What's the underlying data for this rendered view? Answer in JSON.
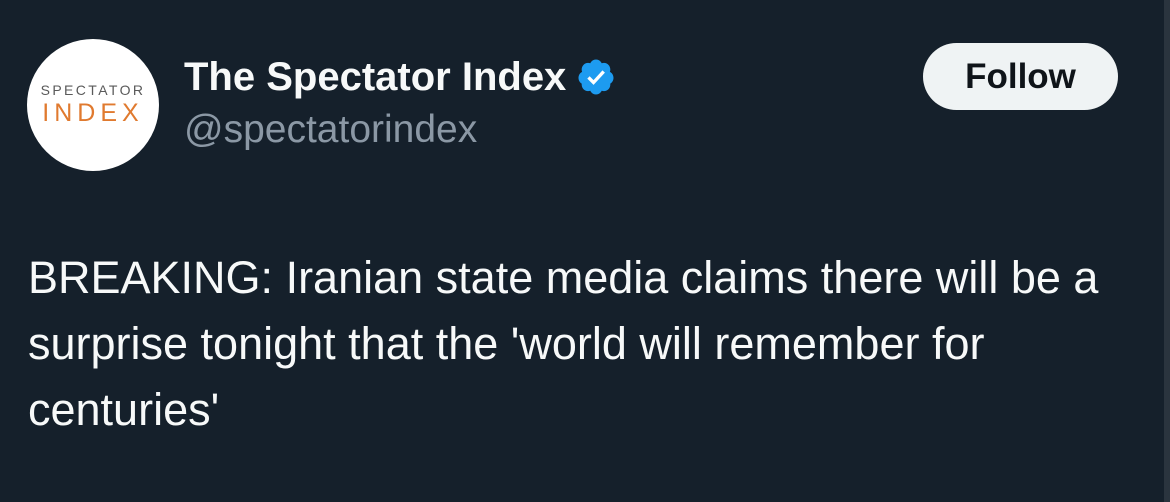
{
  "tweet": {
    "avatar": {
      "logo_top": "SPECTATOR",
      "logo_bottom": "INDEX",
      "logo_top_color": "#5a5a5a",
      "logo_bottom_color": "#e07a2f"
    },
    "display_name": "The Spectator Index",
    "verified": true,
    "verified_color": "#1d9bf0",
    "handle": "@spectatorindex",
    "follow_label": "Follow",
    "text": "BREAKING: Iranian state media claims there will be a surprise tonight that the 'world will remember for centuries'"
  },
  "colors": {
    "background": "#15202b",
    "primary_text": "#f7f9f9",
    "secondary_text": "#8b98a5",
    "button_bg": "#eff3f4",
    "button_text": "#0f1419"
  }
}
